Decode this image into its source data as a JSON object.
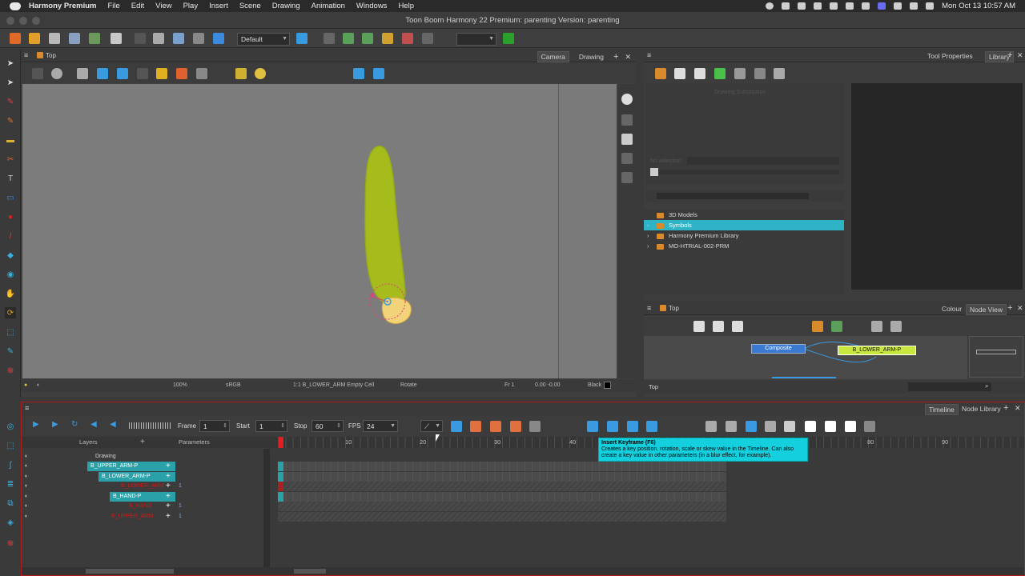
{
  "menubar": {
    "app_name": "Harmony Premium",
    "items": [
      "File",
      "Edit",
      "View",
      "Play",
      "Insert",
      "Scene",
      "Drawing",
      "Animation",
      "Windows",
      "Help"
    ],
    "clock": "Mon Oct 13  10:57 AM"
  },
  "window": {
    "title": "Toon Boom Harmony 22 Premium: parenting Version: parenting"
  },
  "toolbar": {
    "workspace": "Default"
  },
  "camera_view": {
    "breadcrumb": "Top",
    "tabs": [
      "Camera",
      "Drawing"
    ],
    "zoom": "100%",
    "color_space": "sRGB",
    "status_cell": "1:1  B_LOWER_ARM Empty Cell",
    "status_tool": "Rotate",
    "status_frame": "Fr 1",
    "status_coords": "0.00 -0.00",
    "status_bg": "Black"
  },
  "library": {
    "tabs": [
      "Tool Properties",
      "Library"
    ],
    "drawing_substitution": "Drawing Substitution",
    "no_selection": "No selection",
    "items": [
      {
        "label": "3D Models",
        "selected": false,
        "expandable": false
      },
      {
        "label": "Symbols",
        "selected": true,
        "expandable": true
      },
      {
        "label": "Harmony Premium Library",
        "selected": false,
        "expandable": true
      },
      {
        "label": "MO-HTRIAL-002-PRM",
        "selected": false,
        "expandable": true
      }
    ]
  },
  "node_view": {
    "breadcrumb": "Top",
    "tabs": [
      "Colour",
      "Node View"
    ],
    "composite": "Composite",
    "node": "B_LOWER_ARM-P",
    "footer": "Top"
  },
  "timeline": {
    "tabs": [
      "Timeline",
      "Node Library"
    ],
    "frame_label": "Frame",
    "frame": "1",
    "start_label": "Start",
    "start": "1",
    "stop_label": "Stop",
    "stop": "60",
    "fps_label": "FPS",
    "fps": "24",
    "layers_col": "Layers",
    "params_col": "Parameters",
    "ruler": [
      "10",
      "20",
      "30",
      "40",
      "80",
      "90"
    ],
    "layers": [
      {
        "name": "Drawing",
        "kind": "plain",
        "indent": 0,
        "count": ""
      },
      {
        "name": "B_UPPER_ARM-P",
        "kind": "peg",
        "indent": 1,
        "count": ""
      },
      {
        "name": "B_LOWER_ARM-P",
        "kind": "peg",
        "indent": 2,
        "count": ""
      },
      {
        "name": "B_LOWER_ARM",
        "kind": "red",
        "indent": 3,
        "count": "1"
      },
      {
        "name": "B_HAND-P",
        "kind": "peg",
        "indent": 2,
        "count": ""
      },
      {
        "name": "B_HAND",
        "kind": "red",
        "indent": 3,
        "count": "1"
      },
      {
        "name": "B_UPPER_ARM",
        "kind": "red",
        "indent": 2,
        "count": "1"
      }
    ]
  },
  "tooltip": {
    "title": "Insert Keyframe (F6)",
    "body": "Creates a key position, rotation, scale or skew value in the Timeline. Can also create a key value in other parameters (in a blur effect, for example)."
  },
  "colors": {
    "accent": "#2eb3c7",
    "peg": "#2aa0a8",
    "drawing": "#a6bb1c",
    "alert": "#b51a1a"
  }
}
